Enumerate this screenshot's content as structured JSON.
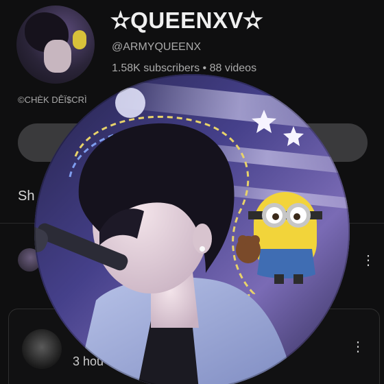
{
  "channel": {
    "name": "✫QUEENXV✫",
    "handle": "@ARMYQUEENX",
    "subscribers": "1.58K subscribers",
    "separator": "•",
    "videos": "88 videos",
    "description": "©CHÈK DÊÏ$CRÌ"
  },
  "tabs": {
    "shorts_label": "Sh"
  },
  "video_card": {
    "time": "3 hou"
  },
  "icons": {
    "kebab": "more-vert-icon"
  }
}
